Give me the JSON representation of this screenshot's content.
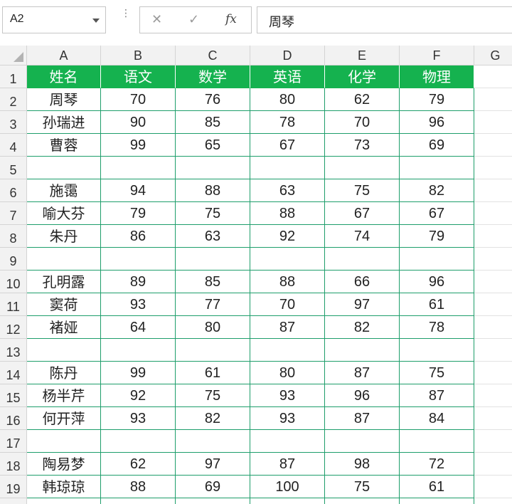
{
  "name_box": "A2",
  "formula_value": "周琴",
  "icons": {
    "cancel": "✕",
    "enter": "✓",
    "fx": "fx",
    "more": "⋮"
  },
  "columns": [
    "A",
    "B",
    "C",
    "D",
    "E",
    "F",
    "G"
  ],
  "row_numbers": [
    "1",
    "2",
    "3",
    "4",
    "5",
    "6",
    "7",
    "8",
    "9",
    "10",
    "11",
    "12",
    "13",
    "14",
    "15",
    "16",
    "17",
    "18",
    "19"
  ],
  "header_row": [
    "姓名",
    "语文",
    "数学",
    "英语",
    "化学",
    "物理"
  ],
  "rows": [
    [
      "周琴",
      "70",
      "76",
      "80",
      "62",
      "79"
    ],
    [
      "孙瑞进",
      "90",
      "85",
      "78",
      "70",
      "96"
    ],
    [
      "曹蓉",
      "99",
      "65",
      "67",
      "73",
      "69"
    ],
    [
      "",
      "",
      "",
      "",
      "",
      ""
    ],
    [
      "施霭",
      "94",
      "88",
      "63",
      "75",
      "82"
    ],
    [
      "喻大芬",
      "79",
      "75",
      "88",
      "67",
      "67"
    ],
    [
      "朱丹",
      "86",
      "63",
      "92",
      "74",
      "79"
    ],
    [
      "",
      "",
      "",
      "",
      "",
      ""
    ],
    [
      "孔明露",
      "89",
      "85",
      "88",
      "66",
      "96"
    ],
    [
      "窦荷",
      "93",
      "77",
      "70",
      "97",
      "61"
    ],
    [
      "褚娅",
      "64",
      "80",
      "87",
      "82",
      "78"
    ],
    [
      "",
      "",
      "",
      "",
      "",
      ""
    ],
    [
      "陈丹",
      "99",
      "61",
      "80",
      "87",
      "75"
    ],
    [
      "杨半芹",
      "92",
      "75",
      "93",
      "96",
      "87"
    ],
    [
      "何开萍",
      "93",
      "82",
      "93",
      "87",
      "84"
    ],
    [
      "",
      "",
      "",
      "",
      "",
      ""
    ],
    [
      "陶易梦",
      "62",
      "97",
      "87",
      "98",
      "72"
    ],
    [
      "韩琼琼",
      "88",
      "69",
      "100",
      "75",
      "61"
    ]
  ],
  "colors": {
    "header_fill": "#15b24f",
    "border": "#1e9e6b"
  }
}
